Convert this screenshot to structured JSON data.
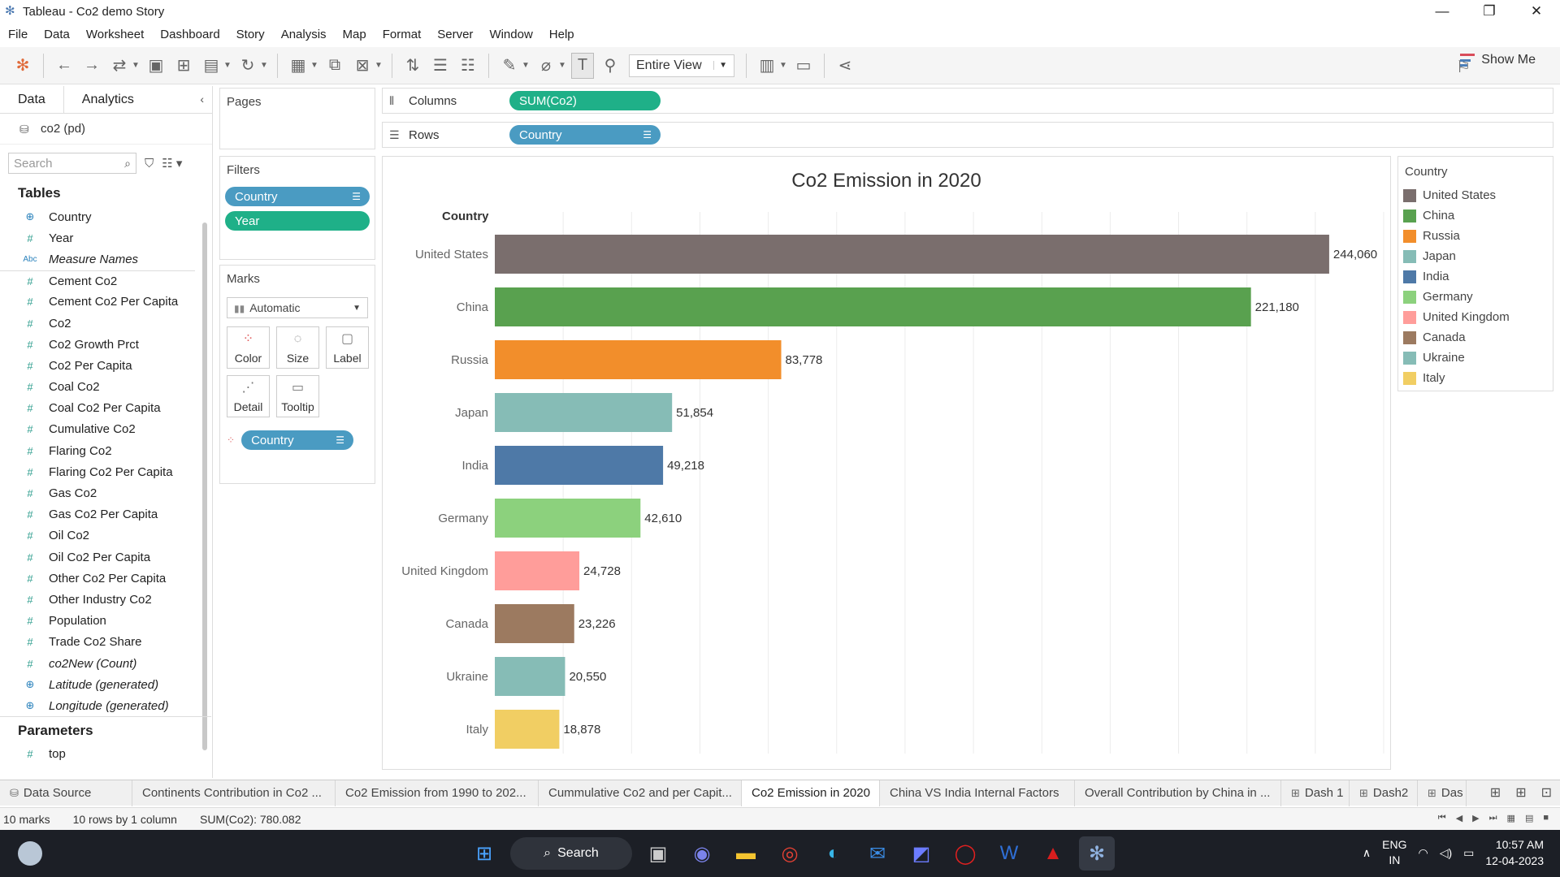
{
  "window": {
    "title": "Tableau - Co2 demo Story",
    "controls": [
      "—",
      "❐",
      "✕"
    ]
  },
  "menu": [
    "File",
    "Data",
    "Worksheet",
    "Dashboard",
    "Story",
    "Analysis",
    "Map",
    "Format",
    "Server",
    "Window",
    "Help"
  ],
  "toolbar": {
    "view_select": "Entire View",
    "show_me": "Show Me"
  },
  "data_pane": {
    "tabs": [
      "Data",
      "Analytics"
    ],
    "datasource": "co2 (pd)",
    "search_placeholder": "Search",
    "tables_heading": "Tables",
    "fields": [
      {
        "name": "Country",
        "type": "geo"
      },
      {
        "name": "Year",
        "type": "num"
      },
      {
        "name": "Measure Names",
        "type": "abc"
      },
      {
        "name": "Cement Co2",
        "type": "num"
      },
      {
        "name": "Cement Co2 Per Capita",
        "type": "num"
      },
      {
        "name": "Co2",
        "type": "num"
      },
      {
        "name": "Co2 Growth Prct",
        "type": "num"
      },
      {
        "name": "Co2 Per Capita",
        "type": "num"
      },
      {
        "name": "Coal Co2",
        "type": "num"
      },
      {
        "name": "Coal Co2 Per Capita",
        "type": "num"
      },
      {
        "name": "Cumulative Co2",
        "type": "num"
      },
      {
        "name": "Flaring Co2",
        "type": "num"
      },
      {
        "name": "Flaring Co2 Per Capita",
        "type": "num"
      },
      {
        "name": "Gas Co2",
        "type": "num"
      },
      {
        "name": "Gas Co2 Per Capita",
        "type": "num"
      },
      {
        "name": "Oil Co2",
        "type": "num"
      },
      {
        "name": "Oil Co2 Per Capita",
        "type": "num"
      },
      {
        "name": "Other Co2 Per Capita",
        "type": "num"
      },
      {
        "name": "Other Industry Co2",
        "type": "num"
      },
      {
        "name": "Population",
        "type": "num"
      },
      {
        "name": "Trade Co2 Share",
        "type": "num"
      },
      {
        "name": "co2New (Count)",
        "type": "num"
      },
      {
        "name": "Latitude (generated)",
        "type": "geo"
      },
      {
        "name": "Longitude (generated)",
        "type": "geo"
      }
    ],
    "parameters_heading": "Parameters",
    "parameters": [
      "top"
    ]
  },
  "shelves": {
    "pages_label": "Pages",
    "filters_label": "Filters",
    "filters": [
      "Country",
      "Year"
    ],
    "marks_label": "Marks",
    "mark_type": "Automatic",
    "mark_cards": [
      "Color",
      "Size",
      "Label",
      "Detail",
      "Tooltip"
    ],
    "marks_field": "Country",
    "columns_label": "Columns",
    "columns_pill": "SUM(Co2)",
    "rows_label": "Rows",
    "rows_pill": "Country"
  },
  "chart_data": {
    "type": "bar",
    "orientation": "horizontal",
    "title": "Co2 Emission in 2020",
    "row_header": "Country",
    "categories": [
      "United States",
      "China",
      "Russia",
      "Japan",
      "India",
      "Germany",
      "United Kingdom",
      "Canada",
      "Ukraine",
      "Italy"
    ],
    "values": [
      244060,
      221180,
      83778,
      51854,
      49218,
      42610,
      24728,
      23226,
      20550,
      18878
    ],
    "labels": [
      "244,060",
      "221,180",
      "83,778",
      "51,854",
      "49,218",
      "42,610",
      "24,728",
      "23,226",
      "20,550",
      "18,878"
    ],
    "colors": [
      "#7a6e6d",
      "#59a14f",
      "#f28e2b",
      "#86bcb6",
      "#4e79a7",
      "#8cd17d",
      "#ff9d9a",
      "#9c7a60",
      "#86bcb6",
      "#f1ce63"
    ],
    "xlim": [
      0,
      260000
    ],
    "grid": true,
    "legend_position": "right"
  },
  "legend": {
    "title": "Country",
    "items": [
      {
        "label": "United States",
        "color": "#7a6e6d"
      },
      {
        "label": "China",
        "color": "#59a14f"
      },
      {
        "label": "Russia",
        "color": "#f28e2b"
      },
      {
        "label": "Japan",
        "color": "#86bcb6"
      },
      {
        "label": "India",
        "color": "#4e79a7"
      },
      {
        "label": "Germany",
        "color": "#8cd17d"
      },
      {
        "label": "United Kingdom",
        "color": "#ff9d9a"
      },
      {
        "label": "Canada",
        "color": "#9c7a60"
      },
      {
        "label": "Ukraine",
        "color": "#86bcb6"
      },
      {
        "label": "Italy",
        "color": "#f1ce63"
      }
    ]
  },
  "sheet_tabs": [
    {
      "label": "Data Source",
      "icon": "database-icon"
    },
    {
      "label": "Continents Contribution in Co2 ...",
      "icon": ""
    },
    {
      "label": "Co2 Emission from 1990 to 202...",
      "icon": ""
    },
    {
      "label": "Cummulative Co2 and per Capit...",
      "icon": ""
    },
    {
      "label": "Co2 Emission in 2020",
      "icon": "",
      "active": true
    },
    {
      "label": "China VS India Internal Factors",
      "icon": ""
    },
    {
      "label": "Overall Contribution by China in ...",
      "icon": ""
    },
    {
      "label": "Dash 1",
      "icon": "dashboard-icon"
    },
    {
      "label": "Dash2",
      "icon": "dashboard-icon"
    },
    {
      "label": "Das",
      "icon": "dashboard-icon"
    }
  ],
  "status": {
    "marks": "10 marks",
    "dims": "10 rows by 1 column",
    "sum": "SUM(Co2): 780.082"
  },
  "taskbar": {
    "search": "Search",
    "lang_top": "ENG",
    "lang_bottom": "IN",
    "time": "10:57 AM",
    "date": "12-04-2023"
  }
}
